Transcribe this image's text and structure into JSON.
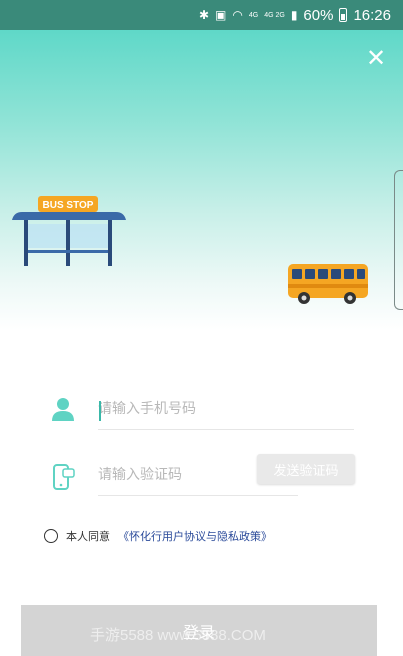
{
  "status_bar": {
    "network_small": "4G",
    "network_small2": "4G 2G",
    "battery": "60%",
    "time": "16:26"
  },
  "hero": {
    "bus_stop_sign": "BUS STOP"
  },
  "close_icon": "close-icon",
  "phone_field": {
    "placeholder": "请输入手机号码",
    "icon": "user-icon"
  },
  "code_field": {
    "placeholder": "请输入验证码",
    "icon": "phone-sms-icon",
    "send_label": "发送验证码"
  },
  "agreement": {
    "prefix": "本人同意",
    "link": "《怀化行用户协议与隐私政策》"
  },
  "login": {
    "label": "登录"
  },
  "watermark": "手游5588 www.5588.COM",
  "colors": {
    "accent": "#5fd8c8",
    "status_bar": "#3a8a7a",
    "link": "#2a4a9a",
    "button_disabled": "#d4d4d4"
  }
}
